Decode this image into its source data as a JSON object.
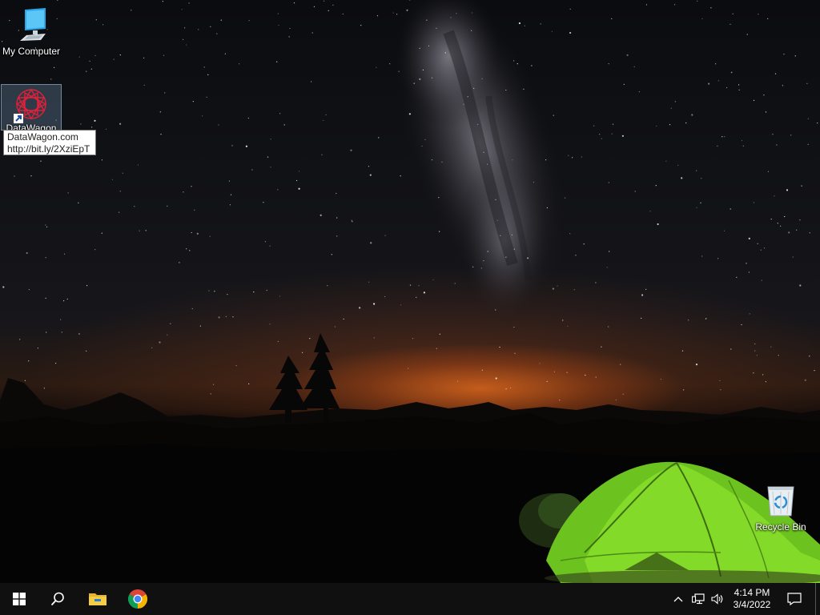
{
  "desktop": {
    "icons": [
      {
        "label": "My Computer",
        "icon": "computer-monitor-icon"
      },
      {
        "label": "DataWagon",
        "icon": "datawagon-shortcut-icon"
      },
      {
        "label": "Recycle Bin",
        "icon": "recycle-bin-icon"
      }
    ],
    "tooltip": {
      "line1": "DataWagon.com",
      "line2": "http://bit.ly/2XziEpT"
    }
  },
  "taskbar": {
    "start_icon": "windows-logo-icon",
    "search_icon": "search-icon",
    "pinned": [
      {
        "icon": "file-explorer-icon"
      },
      {
        "icon": "chrome-icon"
      }
    ],
    "tray": {
      "time": "4:14 PM",
      "date": "3/4/2022",
      "icons": [
        "chevron-up-icon",
        "network-icon",
        "volume-icon",
        "action-center-icon"
      ]
    }
  },
  "colors": {
    "taskbar": "#101010",
    "tent": "#7ed321",
    "glow": "#e8762a"
  }
}
